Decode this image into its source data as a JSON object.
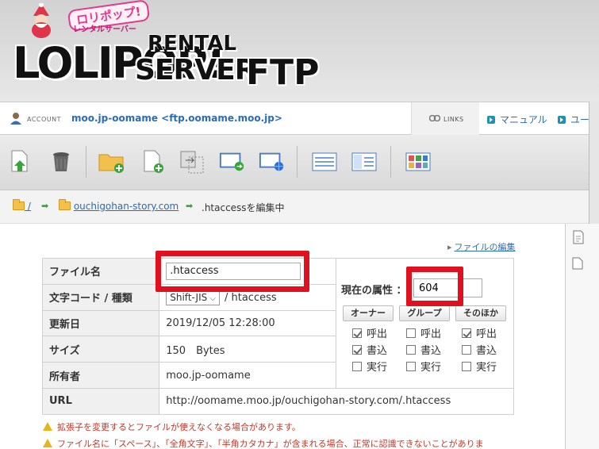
{
  "header": {
    "logo_jp": "ロリポップ!",
    "logo_jp_sub": "レンタルサーバー",
    "logo_main": "LOLIPOP!",
    "logo_rental": "RENTAL",
    "logo_server": "SERVER",
    "logo_ftp": "FTP"
  },
  "account": {
    "label": "ACCOUNT",
    "value": "moo.jp-oomame <ftp.oomame.moo.jp>",
    "links_label": "LINKS",
    "manual_label": "マニュアル",
    "user_label": "ユー"
  },
  "toolbar": {
    "icons": [
      "upload-file-icon",
      "trash-icon",
      "new-folder-icon",
      "new-file-icon",
      "copy-icon",
      "move-icon",
      "web-icon",
      "list-view-icon",
      "detail-view-icon",
      "thumbnail-view-icon"
    ]
  },
  "breadcrumb": {
    "root": "/",
    "folder": "ouchigohan-story.com",
    "current": ".htaccessを編集中"
  },
  "edit_link": "ファイルの編集",
  "file": {
    "name_label": "ファイル名",
    "name_value": ".htaccess",
    "encoding_label": "文字コード / 種類",
    "encoding_value": "Shift-JIS",
    "type_value": "/ htaccess",
    "updated_label": "更新日",
    "updated_value": "2019/12/05 12:28:00",
    "size_label": "サイズ",
    "size_value": "150　Bytes",
    "owner_label": "所有者",
    "owner_value": "moo.jp-oomame",
    "url_label": "URL",
    "url_value": "http://oomame.moo.jp/ouchigohan-story.com/.htaccess"
  },
  "permissions": {
    "title": "現在の属性",
    "value": "604",
    "groups": [
      {
        "label": "オーナー",
        "read": true,
        "write": true,
        "exec": false
      },
      {
        "label": "グループ",
        "read": false,
        "write": false,
        "exec": false
      },
      {
        "label": "そのほか",
        "read": true,
        "write": false,
        "exec": false
      }
    ],
    "read_label": "呼出",
    "write_label": "書込",
    "exec_label": "実行"
  },
  "warnings": [
    "拡張子を変更するとファイルが使えなくなる場合があります。",
    "ファイル名に「スペース」、「全角文字」、「半角カタカナ」が含まれる場合、正常に認識できないことがありま"
  ],
  "colors": {
    "highlight": "#e0101e",
    "link": "#2a6cb5"
  }
}
